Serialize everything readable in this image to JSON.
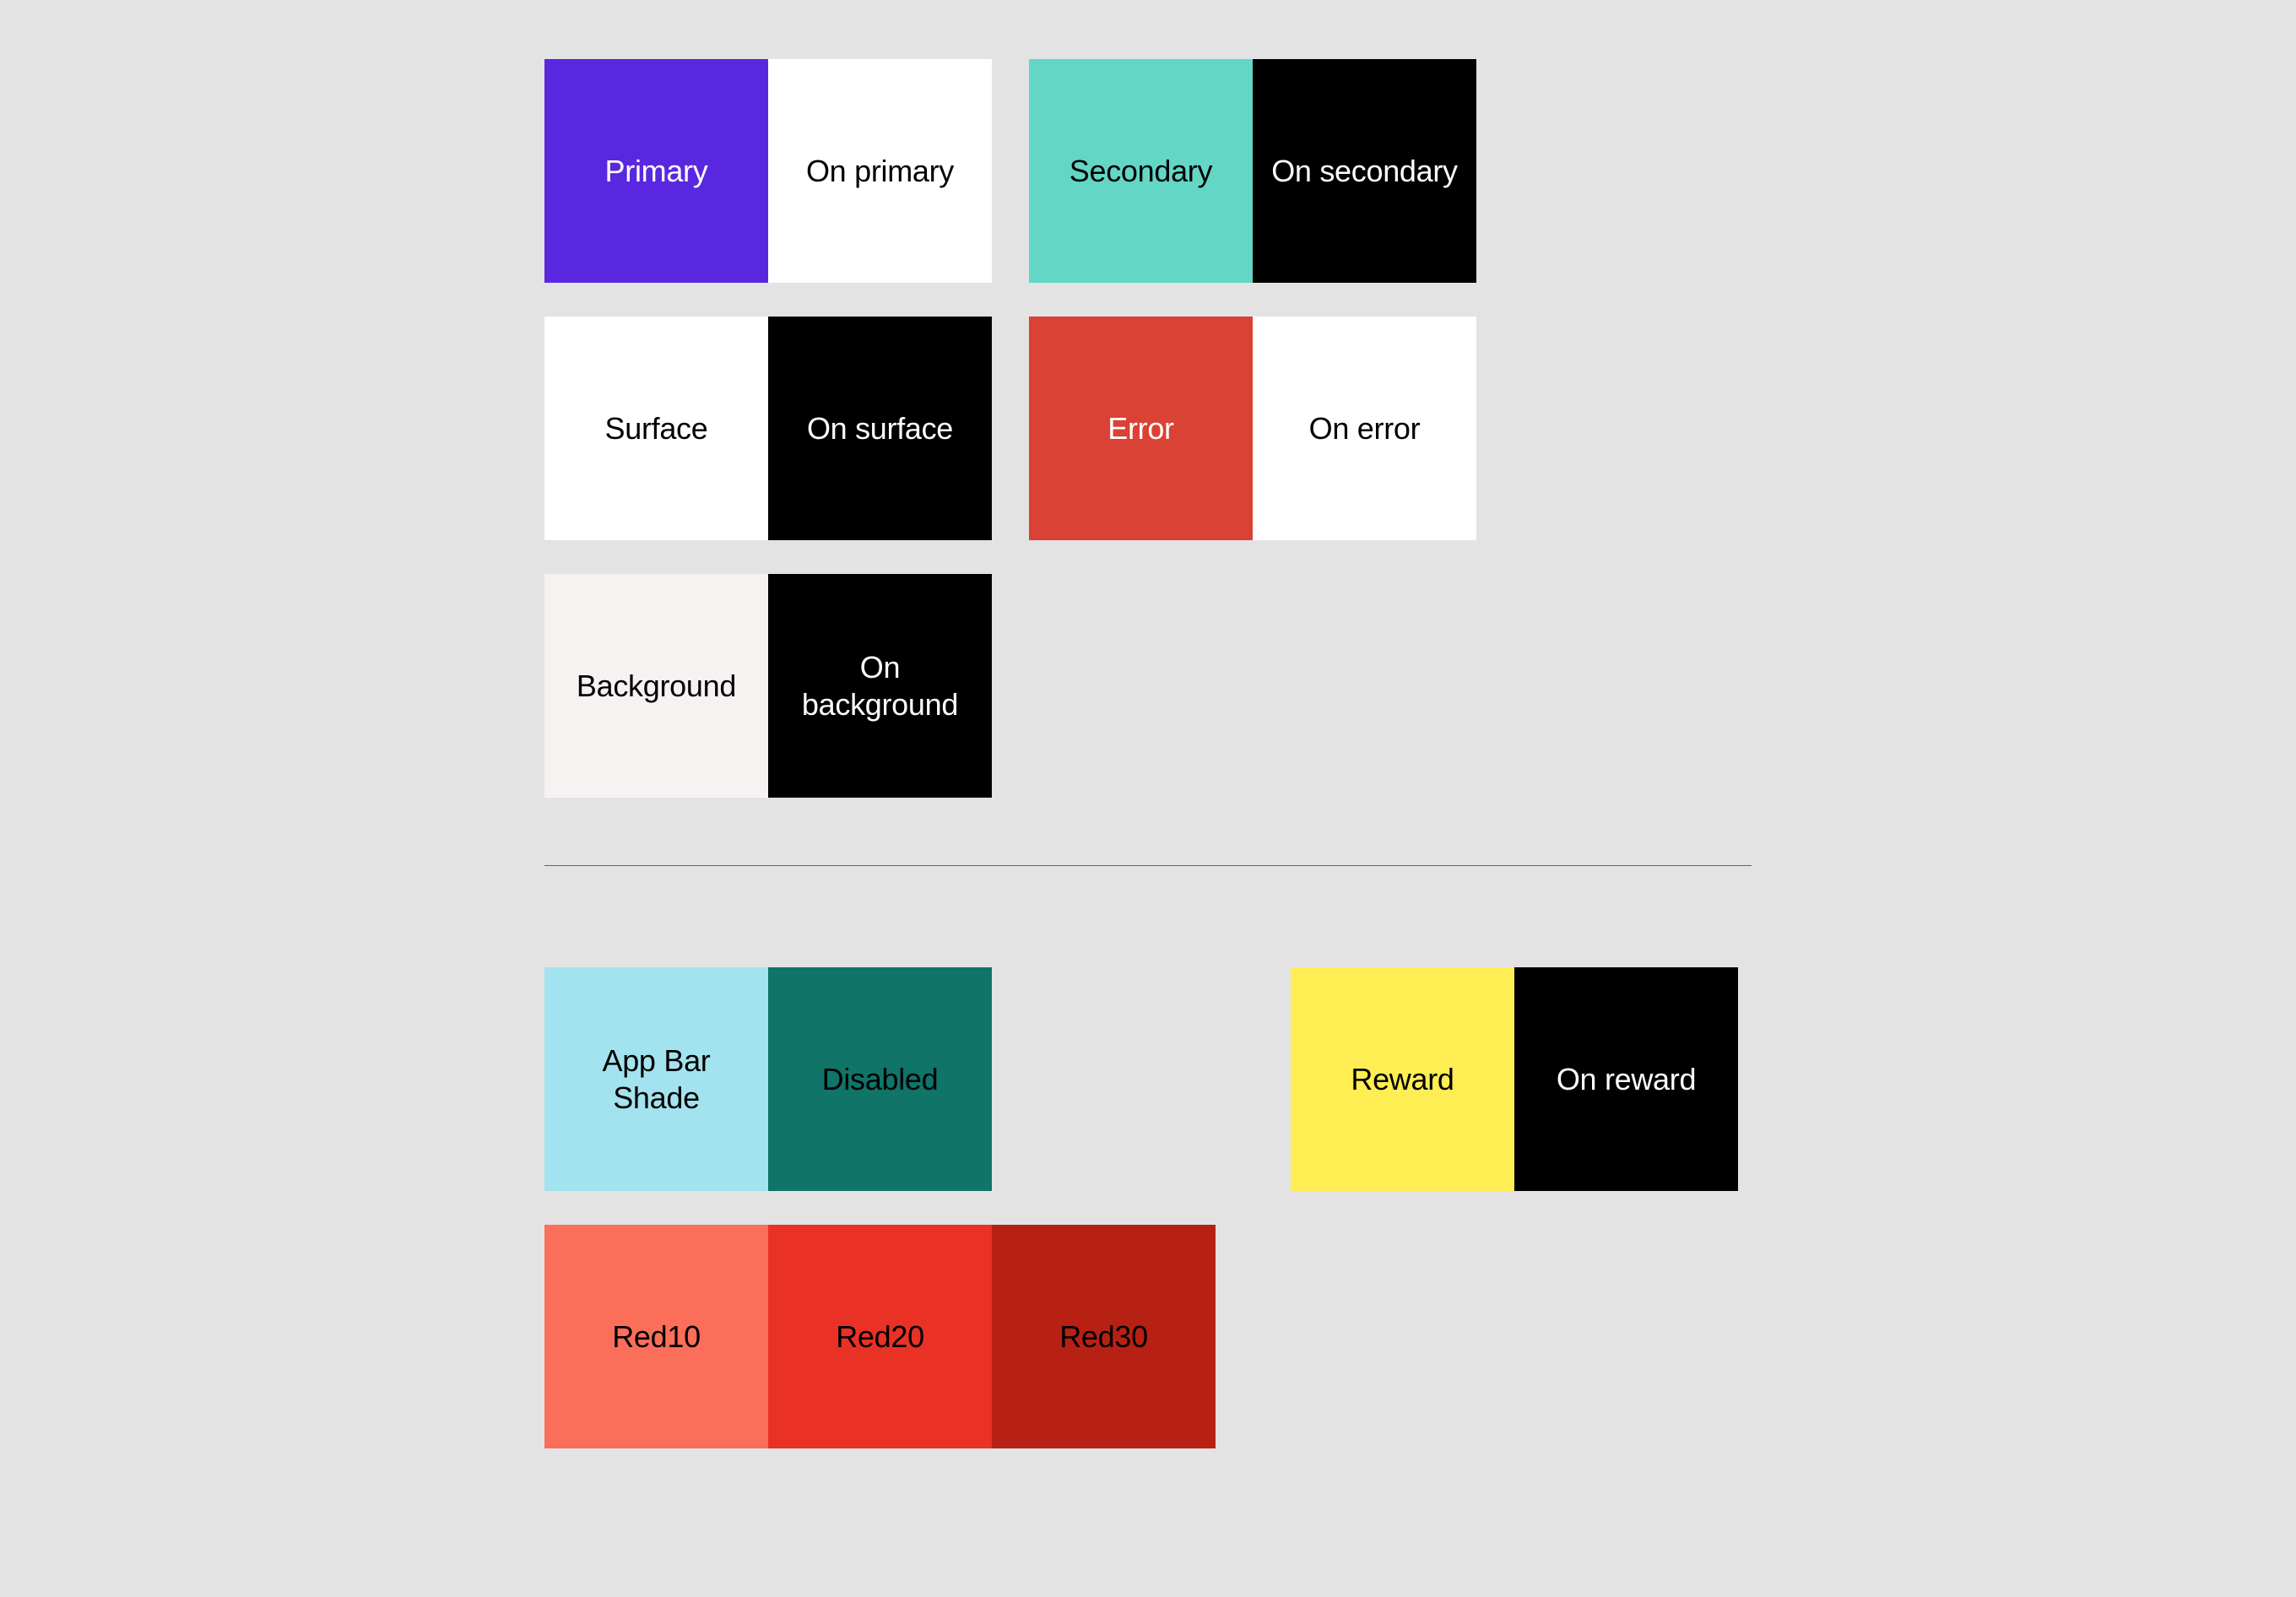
{
  "section1": {
    "row1": {
      "pair1": {
        "left": {
          "label": "Primary",
          "bg": "#5a27e0",
          "fg": "#ffffff"
        },
        "right": {
          "label": "On primary",
          "bg": "#ffffff",
          "fg": "#000000"
        }
      },
      "pair2": {
        "left": {
          "label": "Secondary",
          "bg": "#63d6c6",
          "fg": "#000000"
        },
        "right": {
          "label": "On secondary",
          "bg": "#000000",
          "fg": "#ffffff"
        }
      }
    },
    "row2": {
      "pair1": {
        "left": {
          "label": "Surface",
          "bg": "#ffffff",
          "fg": "#000000"
        },
        "right": {
          "label": "On surface",
          "bg": "#000000",
          "fg": "#ffffff"
        }
      },
      "pair2": {
        "left": {
          "label": "Error",
          "bg": "#d94234",
          "fg": "#ffffff"
        },
        "right": {
          "label": "On error",
          "bg": "#ffffff",
          "fg": "#000000"
        }
      }
    },
    "row3": {
      "pair1": {
        "left": {
          "label": "Background",
          "bg": "#f7f2f2",
          "fg": "#000000"
        },
        "right": {
          "label": "On background",
          "bg": "#000000",
          "fg": "#ffffff"
        }
      }
    }
  },
  "section2": {
    "row1": {
      "pair1": {
        "left": {
          "label": "App Bar Shade",
          "bg": "#a3e3ef",
          "fg": "#000000"
        },
        "right": {
          "label": "Disabled",
          "bg": "#107469",
          "fg": "#000000"
        }
      },
      "pair2": {
        "left": {
          "label": "Reward",
          "bg": "#ffee53",
          "fg": "#000000"
        },
        "right": {
          "label": "On reward",
          "bg": "#000000",
          "fg": "#ffffff"
        }
      }
    },
    "row2": {
      "triple": {
        "a": {
          "label": "Red10",
          "bg": "#fa6e5a",
          "fg": "#000000"
        },
        "b": {
          "label": "Red20",
          "bg": "#e93126",
          "fg": "#000000"
        },
        "c": {
          "label": "Red30",
          "bg": "#b72114",
          "fg": "#000000"
        }
      }
    }
  }
}
